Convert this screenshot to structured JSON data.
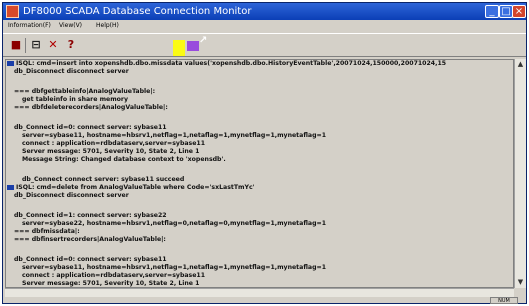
{
  "window": {
    "title": "DF8000 SCADA Database Connection Monitor",
    "menu": [
      "Information(F)",
      "View(V)",
      "Help(H)"
    ]
  },
  "toolbar": {
    "icons": [
      "stop-icon",
      "split-icon",
      "close-icon",
      "help-icon"
    ]
  },
  "log_lines": [
    {
      "text": "ISQL: cmd=insert into xopenshdb.dbo.missdata values('xopenshdb.dbo.HistoryEventTable',20071024,150000,20071024,15",
      "type": "marker"
    },
    {
      "text": "db_Disconnect disconnect server",
      "type": "normal"
    },
    {
      "text": "=== dbfgettableinfo|AnalogValueTable|:",
      "type": "normal"
    },
    {
      "text": "get tableinfo in share memory",
      "type": "indent"
    },
    {
      "text": "=== dbfdeleterecorders|AnalogValueTable|:",
      "type": "normal"
    },
    {
      "text": "db_Connect id=0: connect server: sybase11",
      "type": "normal"
    },
    {
      "text": "server=sybase11, hostname=hbsrv1,netflag=1,netaflag=1,mynetflag=1,mynetaflag=1",
      "type": "indent"
    },
    {
      "text": "connect : application=rdbdataserv,server=sybase11",
      "type": "indent"
    },
    {
      "text": "Server message: 5701, Severity 10, State 2, Line 1",
      "type": "indent"
    },
    {
      "text": "Message String: Changed database context to 'xopensdb'.",
      "type": "indent"
    },
    {
      "text": "db_Connect connect server: sybase11 succeed",
      "type": "indent"
    },
    {
      "text": "ISQL: cmd=delete from AnalogValueTable where Code='sxLastTmYc'",
      "type": "marker"
    },
    {
      "text": "db_Disconnect disconnect server",
      "type": "normal"
    },
    {
      "text": "db_Connect id=1: connect server: sybase22",
      "type": "normal"
    },
    {
      "text": "server=sybase22, hostname=hbsrv1,netflag=0,netaflag=0,mynetflag=1,mynetaflag=1",
      "type": "indent"
    },
    {
      "text": "=== dbfmissdata|:",
      "type": "normal"
    },
    {
      "text": "=== dbfinsertrecorders|AnalogValueTable|:",
      "type": "normal"
    },
    {
      "text": "db_Connect id=0: connect server: sybase11",
      "type": "normal"
    },
    {
      "text": "server=sybase11, hostname=hbsrv1,netflag=1,netaflag=1,mynetflag=1,mynetaflag=1",
      "type": "indent"
    },
    {
      "text": "connect : application=rdbdataserv,server=sybase11",
      "type": "indent"
    },
    {
      "text": "Server message: 5701, Severity 10, State 2, Line 1",
      "type": "indent"
    }
  ],
  "status": {
    "indicator": "NUM"
  }
}
